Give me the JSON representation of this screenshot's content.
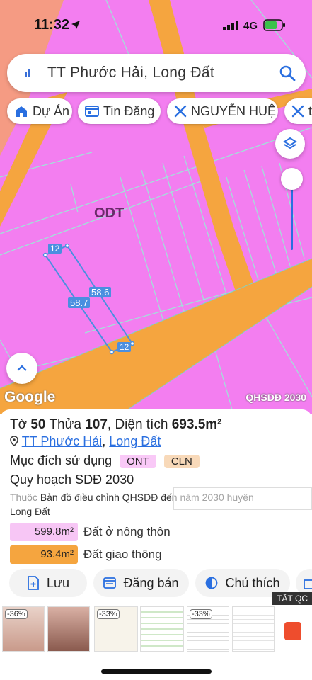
{
  "status": {
    "time": "11:32",
    "network": "4G"
  },
  "search": {
    "query": "TT Phước Hải, Long Đất"
  },
  "chips": [
    {
      "label": "Dự Án",
      "icon": "map-home-icon"
    },
    {
      "label": "Tin Đăng",
      "icon": "listing-icon"
    },
    {
      "label": "NGUYỄN HUỆ",
      "icon": "road-icon"
    },
    {
      "label": "t",
      "icon": "road-icon"
    }
  ],
  "map": {
    "zone_label": "ODT",
    "plot_edges": [
      "12",
      "58.6",
      "58.7",
      "12"
    ],
    "attribution": "Google",
    "layer_name": "QHSDĐ 2030",
    "colors": {
      "land": "#f37ef0",
      "road": "#f5a53f",
      "plot_line": "#4a8fe0"
    }
  },
  "parcel": {
    "title_prefix": "Tờ",
    "sheet": "50",
    "parcel_label": "Thửa",
    "parcel_no": "107",
    "area_label": "Diện tích",
    "area_value": "693.5m²",
    "location_pin": "pin-icon",
    "location_a": "TT Phước Hải",
    "location_sep": ",",
    "location_b": "Long Đất",
    "use_label": "Mục đích sử dụng",
    "use_tags": [
      {
        "code": "ONT",
        "color": "#f9c9f7"
      },
      {
        "code": "CLN",
        "color": "#f8d9b9"
      }
    ],
    "plan_label": "Quy hoạch SDĐ 2030",
    "note_prefix": "Thuộc",
    "note_text": "Bản đồ điều chỉnh QHSDĐ đến năm 2030 huyện",
    "note_text2": "Long Đất",
    "legend": [
      {
        "value": "599.8m²",
        "label": "Đất ở nông thôn",
        "color": "#f7c6f5"
      },
      {
        "value": "93.4m²",
        "label": "Đất giao thông",
        "color": "#f5a53f"
      }
    ]
  },
  "actions": [
    {
      "label": "Lưu",
      "icon": "save-icon"
    },
    {
      "label": "Đăng bán",
      "icon": "listing-icon"
    },
    {
      "label": "Chú thích",
      "icon": "contrast-icon"
    }
  ],
  "ad": {
    "close_label": "TẮT QC",
    "discounts": [
      "-36%",
      "-33%",
      "-33%"
    ]
  }
}
